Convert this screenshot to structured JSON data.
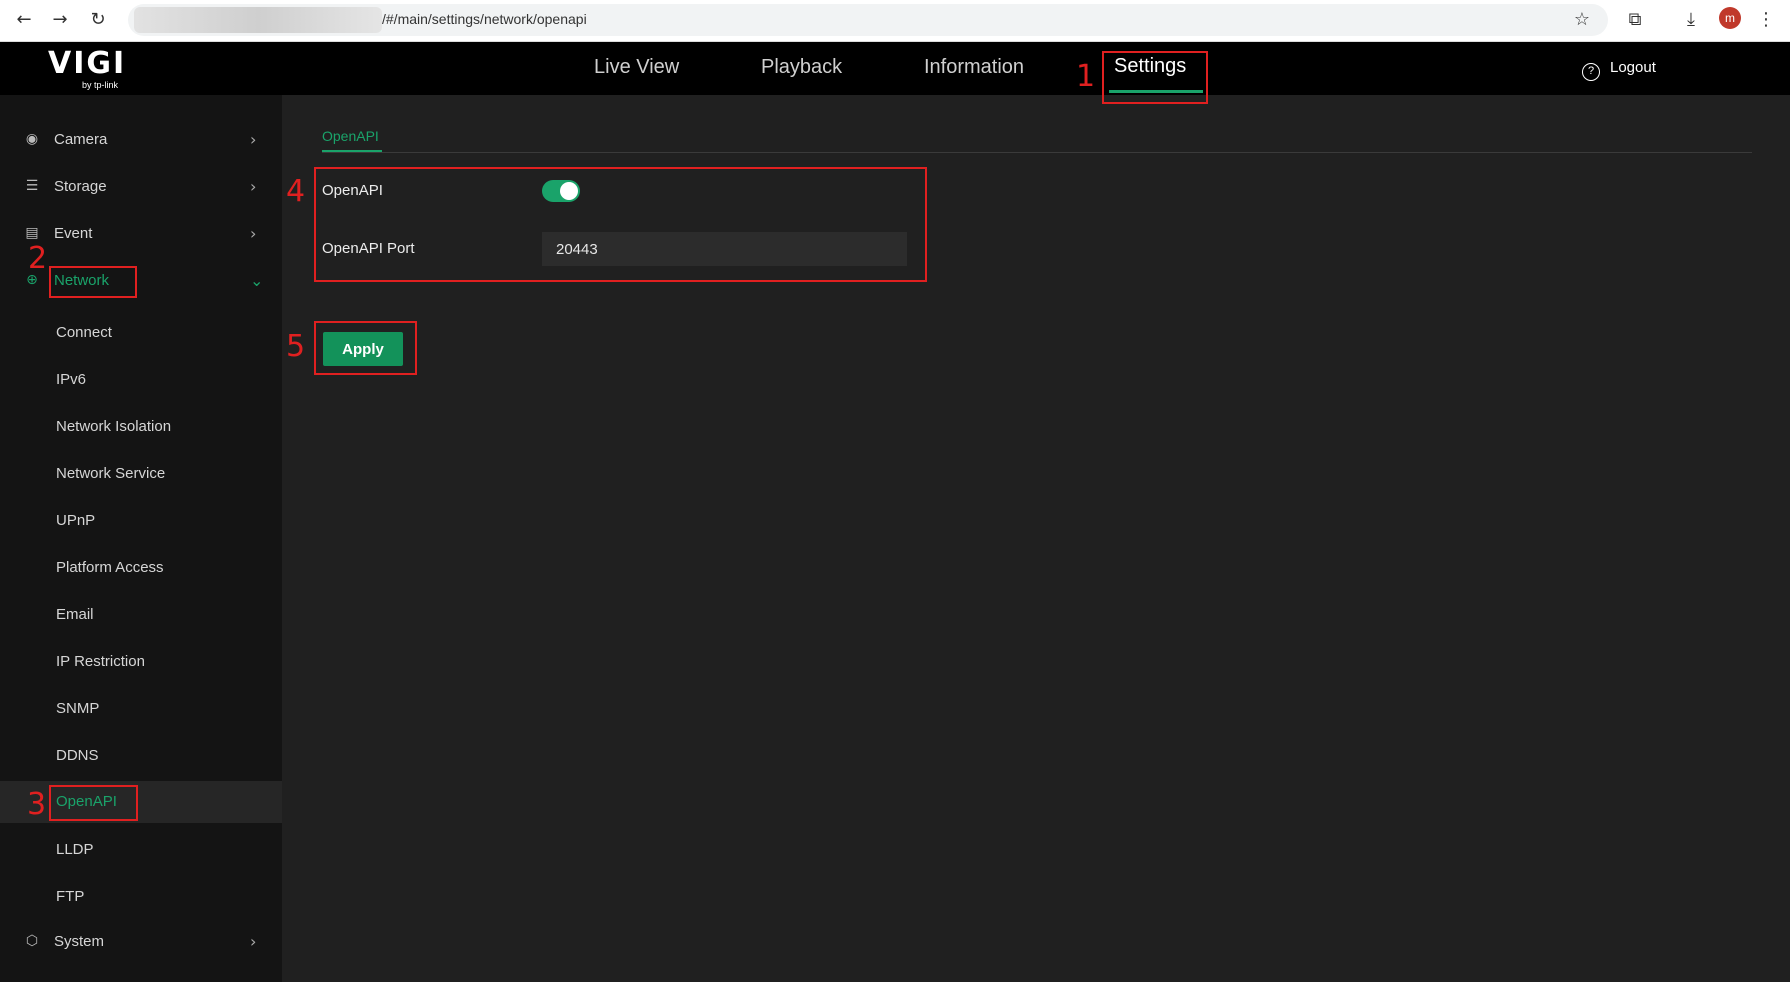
{
  "browser": {
    "url_text": "/#/main/settings/network/openapi",
    "avatar_letter": "m",
    "icons": [
      "back-arrow-icon",
      "forward-arrow-icon",
      "reload-icon",
      "star-icon",
      "extensions-icon",
      "download-icon",
      "kebab-menu-icon"
    ]
  },
  "header": {
    "logo_text": "VIGI",
    "logo_sub": "by tp-link",
    "nav": [
      "Live View",
      "Playback",
      "Information",
      "Settings"
    ],
    "active_nav": "Settings",
    "logout_label": "Logout"
  },
  "sidebar": {
    "items": [
      {
        "label": "Camera",
        "icon": "camera-icon"
      },
      {
        "label": "Storage",
        "icon": "storage-icon"
      },
      {
        "label": "Event",
        "icon": "event-icon"
      },
      {
        "label": "Network",
        "icon": "globe-icon"
      }
    ],
    "network_subitems": [
      "Connect",
      "IPv6",
      "Network Isolation",
      "Network Service",
      "UPnP",
      "Platform Access",
      "Email",
      "IP Restriction",
      "SNMP",
      "DDNS",
      "OpenAPI",
      "LLDP",
      "FTP"
    ],
    "active_subitem": "OpenAPI",
    "system_label": "System"
  },
  "main": {
    "tab_label": "OpenAPI",
    "openapi_label": "OpenAPI",
    "openapi_enabled": true,
    "port_label": "OpenAPI Port",
    "port_value": "20443",
    "apply_label": "Apply"
  },
  "annotations": [
    "1",
    "2",
    "3",
    "4",
    "5"
  ],
  "colors": {
    "accent": "#1aa36a",
    "annotation": "#e02020",
    "background": "#202020"
  }
}
